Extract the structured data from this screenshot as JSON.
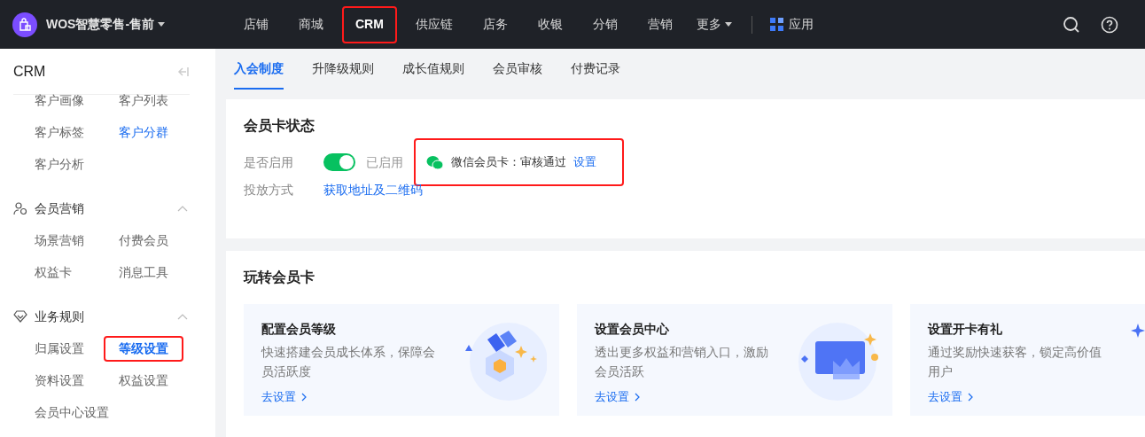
{
  "app": {
    "name": "WOS智慧零售-售前"
  },
  "nav": [
    {
      "label": "店铺",
      "selected": false,
      "highlighted": false
    },
    {
      "label": "商城",
      "selected": false,
      "highlighted": false
    },
    {
      "label": "CRM",
      "selected": true,
      "highlighted": true
    },
    {
      "label": "供应链",
      "selected": false,
      "highlighted": false
    },
    {
      "label": "店务",
      "selected": false,
      "highlighted": false
    },
    {
      "label": "收银",
      "selected": false,
      "highlighted": false
    },
    {
      "label": "分销",
      "selected": false,
      "highlighted": false
    },
    {
      "label": "营销",
      "selected": false,
      "highlighted": false
    }
  ],
  "more": {
    "label": "更多"
  },
  "apps": {
    "label": "应用"
  },
  "sidebar": {
    "title": "CRM",
    "groups": [
      {
        "items": [
          {
            "label": "客户画像",
            "selected": false,
            "hover": false,
            "highlighted": false
          },
          {
            "label": "客户列表",
            "selected": false,
            "hover": false,
            "highlighted": false
          },
          {
            "label": "客户标签",
            "selected": false,
            "hover": false,
            "highlighted": false
          },
          {
            "label": "客户分群",
            "selected": false,
            "hover": true,
            "highlighted": false
          },
          {
            "label": "客户分析",
            "selected": false,
            "hover": false,
            "highlighted": false
          }
        ]
      },
      {
        "title": "会员营销",
        "kind": "person",
        "expanded": true,
        "items": [
          {
            "label": "场景营销",
            "selected": false,
            "hover": false,
            "highlighted": false
          },
          {
            "label": "付费会员",
            "selected": false,
            "hover": false,
            "highlighted": false
          },
          {
            "label": "权益卡",
            "selected": false,
            "hover": false,
            "highlighted": false
          },
          {
            "label": "消息工具",
            "selected": false,
            "hover": false,
            "highlighted": false
          }
        ]
      },
      {
        "title": "业务规则",
        "kind": "diamond",
        "expanded": true,
        "items": [
          {
            "label": "归属设置",
            "selected": false,
            "hover": false,
            "highlighted": false
          },
          {
            "label": "等级设置",
            "selected": true,
            "hover": false,
            "highlighted": true
          },
          {
            "label": "资料设置",
            "selected": false,
            "hover": false,
            "highlighted": false
          },
          {
            "label": "权益设置",
            "selected": false,
            "hover": false,
            "highlighted": false
          },
          {
            "label": "会员中心设置",
            "selected": false,
            "hover": false,
            "highlighted": false
          }
        ]
      }
    ]
  },
  "tabs": [
    {
      "label": "入会制度",
      "selected": true
    },
    {
      "label": "升降级规则",
      "selected": false
    },
    {
      "label": "成长值规则",
      "selected": false
    },
    {
      "label": "会员审核",
      "selected": false
    },
    {
      "label": "付费记录",
      "selected": false
    }
  ],
  "card_status": {
    "title": "会员卡状态",
    "enable": {
      "label": "是否启用",
      "on": true,
      "state_text": "已启用"
    },
    "wechat": {
      "status": "微信会员卡：审核通过",
      "link": "设置",
      "highlighted": true
    },
    "delivery": {
      "label": "投放方式",
      "link": "获取地址及二维码"
    }
  },
  "play": {
    "title": "玩转会员卡",
    "cards": [
      {
        "kind": "medal",
        "title": "配置会员等级",
        "desc": "快速搭建会员成长体系，保障会员活跃度",
        "action": "去设置"
      },
      {
        "kind": "vip",
        "title": "设置会员中心",
        "desc": "透出更多权益和营销入口，激励会员活跃",
        "action": "去设置"
      },
      {
        "kind": "gift",
        "title": "设置开卡有礼",
        "desc": "通过奖励快速获客，锁定高价值用户",
        "action": "去设置"
      }
    ]
  }
}
